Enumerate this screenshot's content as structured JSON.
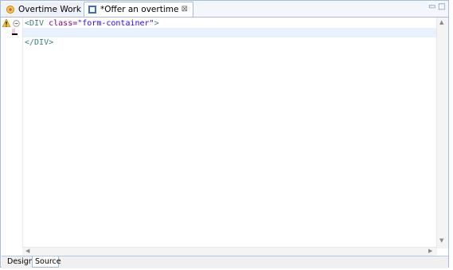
{
  "tabs": [
    {
      "label": "Overtime Work",
      "active": false
    },
    {
      "label": "*Offer an overtime work",
      "active": true
    }
  ],
  "editor": {
    "lines": [
      {
        "tag_open": "<DIV ",
        "attr": "class=",
        "value": "\"form-container\"",
        "tag_close": ">"
      },
      {
        "text": ""
      },
      {
        "text": "</DIV>"
      }
    ]
  },
  "bottom_tabs": [
    "Design",
    "Source"
  ],
  "colors": {
    "border": "#a7bcd6",
    "current_line": "#e8f2fe"
  },
  "icons": {
    "warning": "warning-icon",
    "fold": "fold-minus-icon",
    "close": "close-icon",
    "minimize": "minimize-icon",
    "maximize": "maximize-icon"
  }
}
